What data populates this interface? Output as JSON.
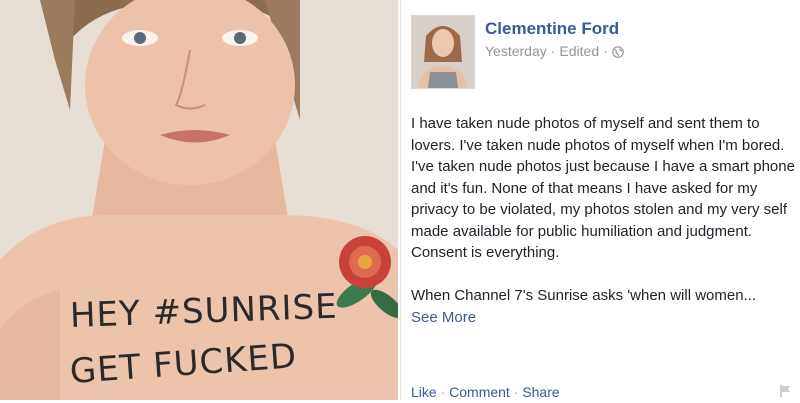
{
  "photo": {
    "line1": "HEY #SUNRISE",
    "line2": "GET FUCKED"
  },
  "post": {
    "author": "Clementine Ford",
    "time": "Yesterday",
    "edited": "Edited",
    "separator": "·",
    "paragraph1": "I have taken nude photos of myself and sent them to lovers. I've taken nude photos of myself when I'm bored. I've taken nude photos just because I have a smart phone and it's fun. None of that means I have asked for my privacy to be violated, my photos stolen and my very self made available for public humiliation and judgment. Consent is everything.",
    "paragraph2": "When Channel 7's Sunrise asks 'when will women...",
    "see_more": "See More",
    "actions": {
      "like": "Like",
      "comment": "Comment",
      "share": "Share"
    }
  },
  "colors": {
    "link": "#3b5998",
    "meta": "#90949c",
    "text": "#1d2129"
  },
  "icons": [
    "globe-icon",
    "flag-icon"
  ]
}
